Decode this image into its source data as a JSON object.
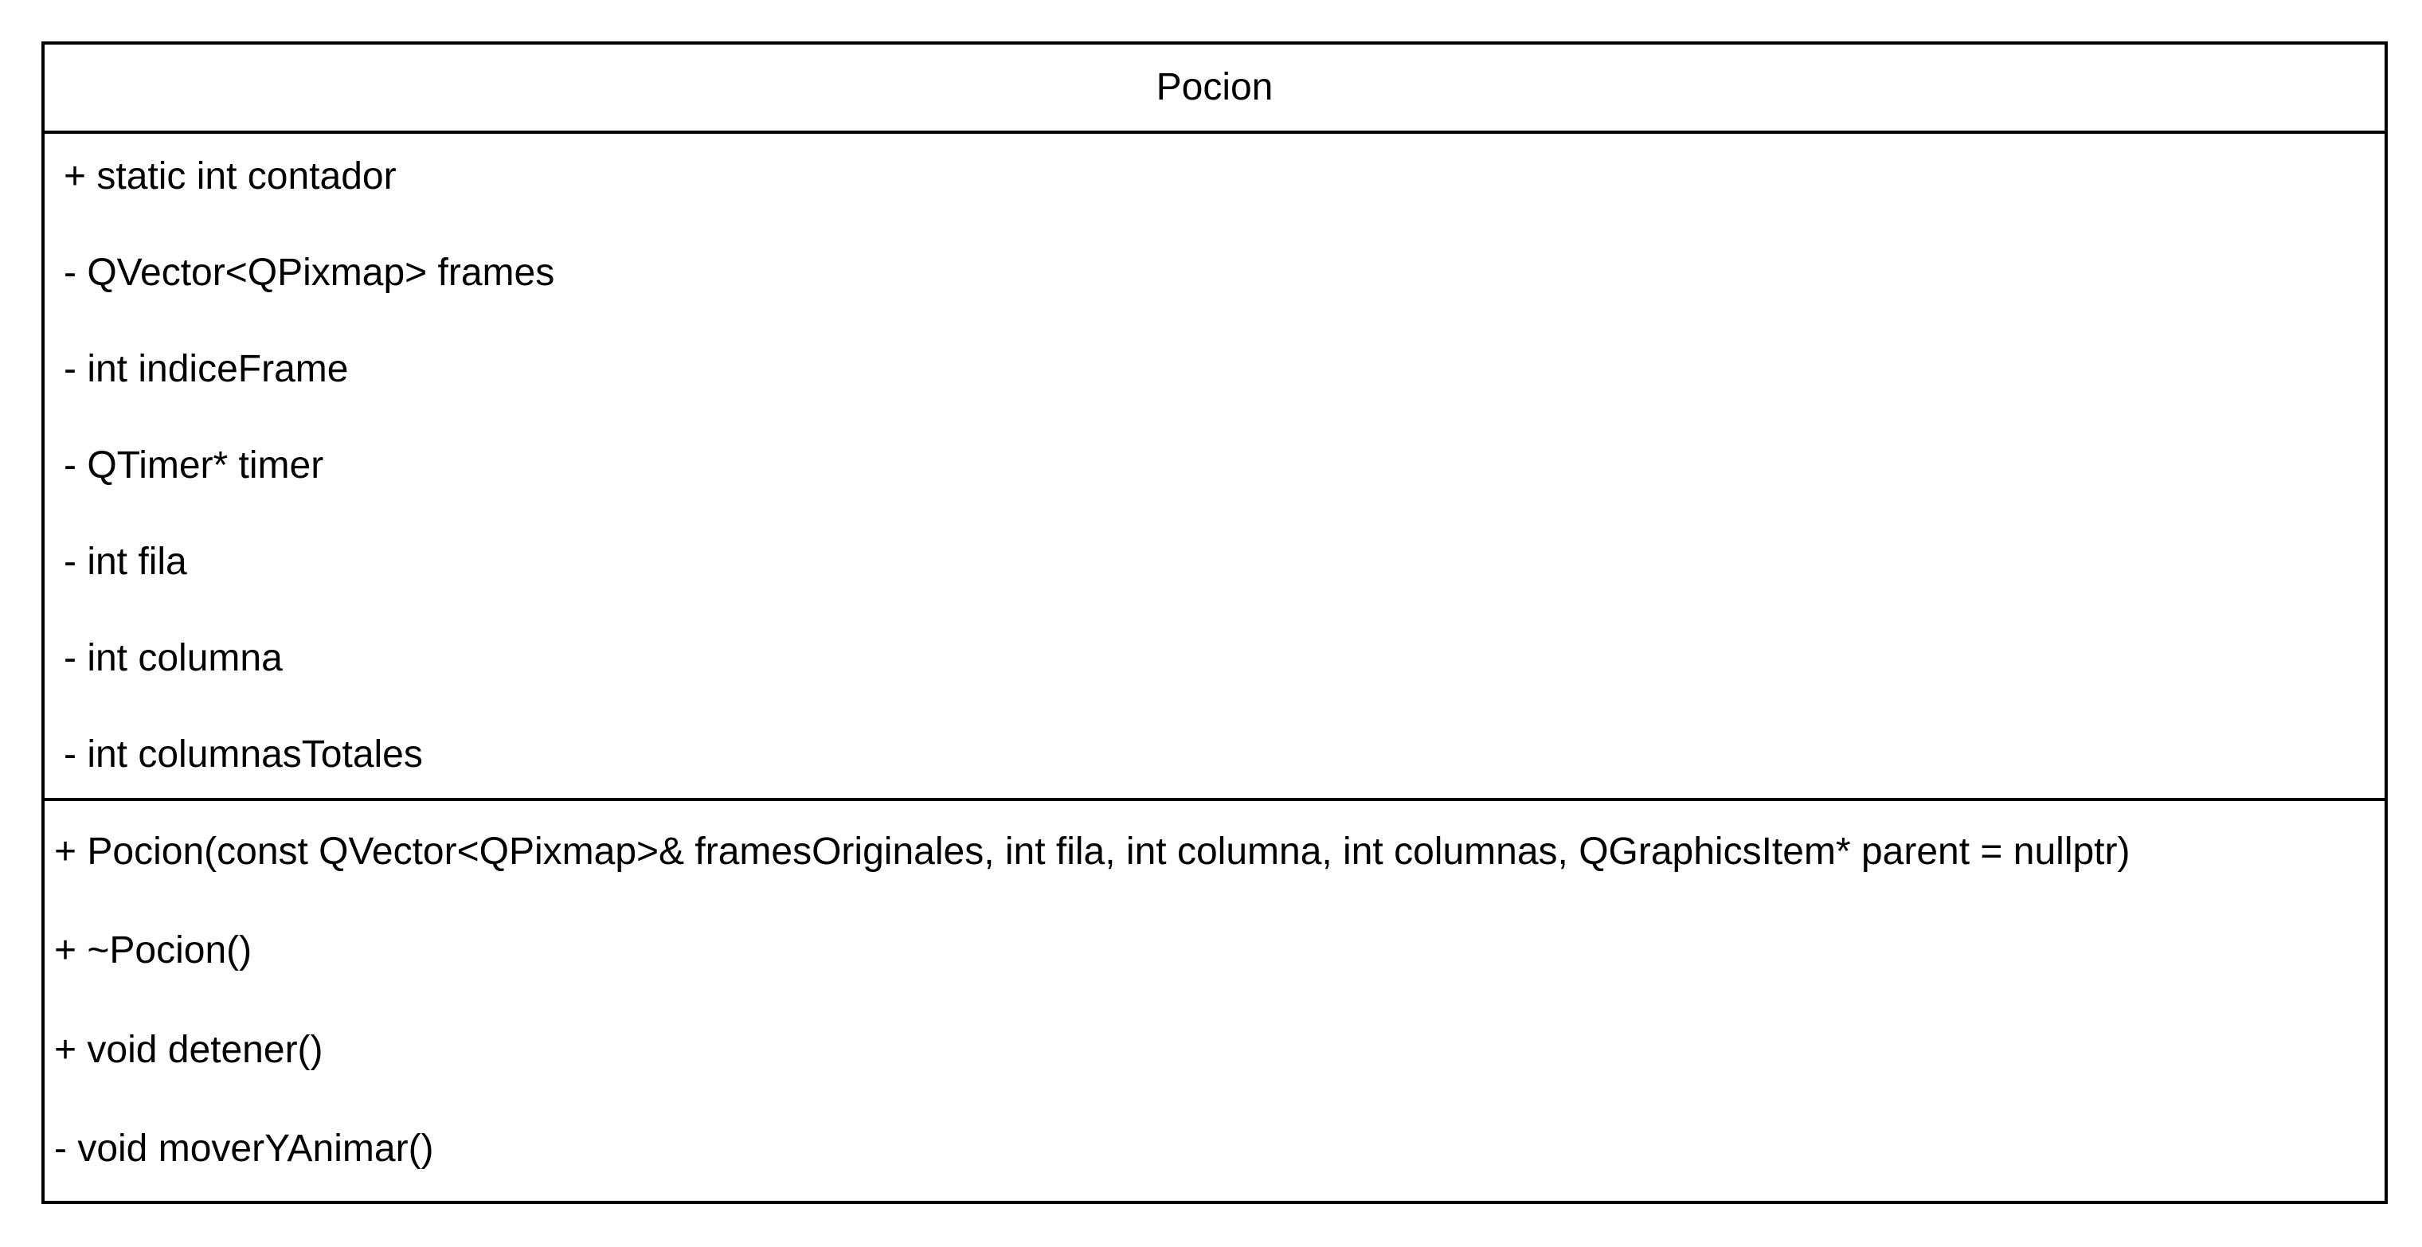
{
  "class": {
    "name": "Pocion",
    "attributes": [
      "+ static int contador",
      "- QVector<QPixmap> frames",
      "- int indiceFrame",
      "- QTimer* timer",
      "- int fila",
      "- int columna",
      "- int columnasTotales"
    ],
    "methods": [
      "+ Pocion(const QVector<QPixmap>& framesOriginales, int fila, int columna, int columnas, QGraphicsItem* parent = nullptr)",
      "+ ~Pocion()",
      "+ void detener()",
      "- void moverYAnimar()"
    ]
  }
}
